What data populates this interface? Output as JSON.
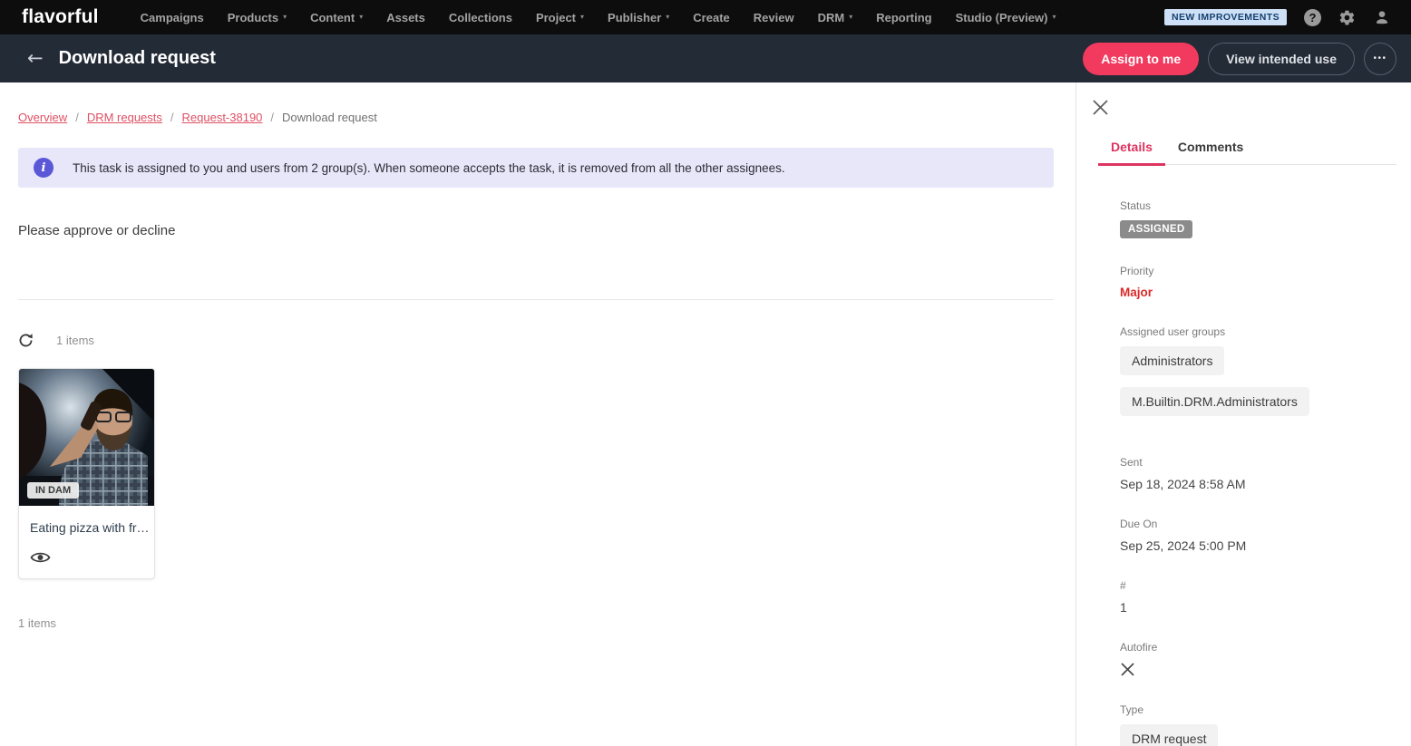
{
  "icons": {
    "back": "←",
    "caret": "▾",
    "more": "•••",
    "info": "i",
    "help": "?"
  },
  "topnav": {
    "logo": "flavorful",
    "items": [
      {
        "label": "Campaigns"
      },
      {
        "label": "Products"
      },
      {
        "label": "Content"
      },
      {
        "label": "Assets"
      },
      {
        "label": "Collections"
      },
      {
        "label": "Project"
      },
      {
        "label": "Publisher"
      },
      {
        "label": "Create"
      },
      {
        "label": "Review"
      },
      {
        "label": "DRM"
      },
      {
        "label": "Reporting"
      },
      {
        "label": "Studio (Preview)"
      }
    ],
    "badge": "NEW IMPROVEMENTS"
  },
  "header": {
    "title": "Download request",
    "assign_label": "Assign to me",
    "view_label": "View intended use"
  },
  "breadcrumb": {
    "separator": "/",
    "links": [
      "Overview",
      "DRM requests",
      "Request-38190"
    ],
    "current": "Download request"
  },
  "banner": {
    "text": "This task is assigned to you and users from 2 group(s). When someone accepts the task, it is removed from all the other assignees."
  },
  "main": {
    "instruction": "Please approve or decline",
    "items_count_top": "1 items",
    "items_count_bottom": "1 items",
    "asset": {
      "badge": "IN DAM",
      "title": "Eating pizza with fr…"
    }
  },
  "panel": {
    "tabs": [
      {
        "label": "Details"
      },
      {
        "label": "Comments"
      }
    ],
    "fields": {
      "status_label": "Status",
      "status_value": "ASSIGNED",
      "priority_label": "Priority",
      "priority_value": "Major",
      "groups_label": "Assigned user groups",
      "groups": [
        "Administrators",
        "M.Builtin.DRM.Administrators"
      ],
      "sent_label": "Sent",
      "sent_value": "Sep 18, 2024 8:58 AM",
      "due_label": "Due On",
      "due_value": "Sep 25, 2024 5:00 PM",
      "number_label": "#",
      "number_value": "1",
      "autofire_label": "Autofire",
      "type_label": "Type",
      "type_value": "DRM request"
    }
  },
  "colors": {
    "accent_pink": "#f23a5f",
    "tab_active": "#dd3460",
    "link_red": "#df5064",
    "priority_red": "#d92b2b",
    "banner_bg": "#e8e7fa",
    "banner_icon": "#5b58d8",
    "improvements_bg": "#cde0f6",
    "improvements_text": "#16406e",
    "status_badge_bg": "#8b8b8b",
    "topnav_bg": "#0d0d0d",
    "header_bg": "#232b37"
  }
}
